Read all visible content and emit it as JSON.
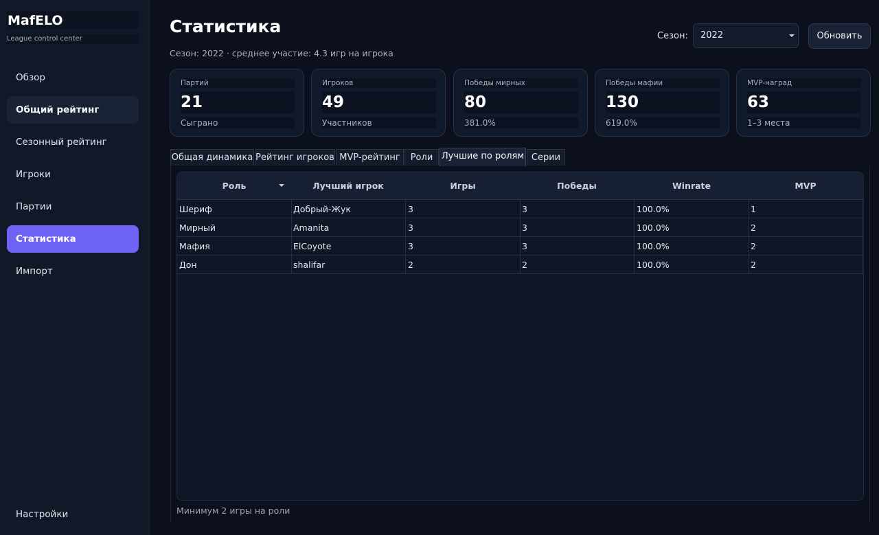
{
  "sidebar": {
    "brand": "MafELO",
    "subtitle": "League control center",
    "items": [
      {
        "label": "Обзор"
      },
      {
        "label": "Общий рейтинг"
      },
      {
        "label": "Сезонный рейтинг"
      },
      {
        "label": "Игроки"
      },
      {
        "label": "Партии"
      },
      {
        "label": "Статистика"
      },
      {
        "label": "Импорт"
      }
    ],
    "settings": "Настройки"
  },
  "header": {
    "title": "Статистика",
    "subtitle": "Сезон: 2022 · среднее участие: 4.3 игр на игрока",
    "season_label": "Сезон:",
    "season_value": "2022",
    "refresh_label": "Обновить"
  },
  "cards": [
    {
      "label": "Партий",
      "value": "21",
      "foot": "Сыграно"
    },
    {
      "label": "Игроков",
      "value": "49",
      "foot": "Участников"
    },
    {
      "label": "Победы мирных",
      "value": "80",
      "foot": "381.0%"
    },
    {
      "label": "Победы мафии",
      "value": "130",
      "foot": "619.0%"
    },
    {
      "label": "MVP-наград",
      "value": "63",
      "foot": "1–3 места"
    }
  ],
  "tabs": [
    {
      "label": "Общая динамика"
    },
    {
      "label": "Рейтинг игроков"
    },
    {
      "label": "MVP-рейтинг"
    },
    {
      "label": "Роли"
    },
    {
      "label": "Лучшие по ролям"
    },
    {
      "label": "Серии"
    }
  ],
  "table": {
    "columns": [
      "Роль",
      "Лучший игрок",
      "Игры",
      "Победы",
      "Winrate",
      "MVP"
    ],
    "rows": [
      [
        "Шериф",
        "Добрый-Жук",
        "3",
        "3",
        "100.0%",
        "1"
      ],
      [
        "Мирный",
        "Amanita",
        "3",
        "3",
        "100.0%",
        "2"
      ],
      [
        "Мафия",
        "ElCoyote",
        "3",
        "3",
        "100.0%",
        "2"
      ],
      [
        "Дон",
        "shalifar",
        "2",
        "2",
        "100.0%",
        "2"
      ]
    ]
  },
  "footnote": "Минимум 2 игры на роли"
}
